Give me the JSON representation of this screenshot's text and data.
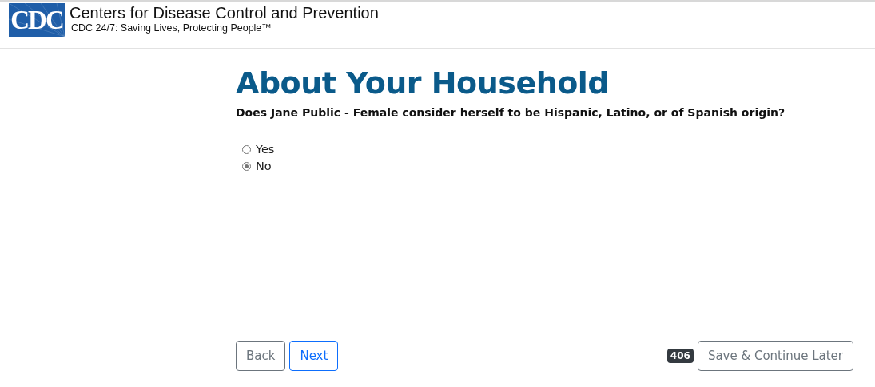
{
  "header": {
    "logo": "CDC",
    "title": "Centers for Disease Control and Prevention",
    "tagline": "CDC 24/7: Saving Lives, Protecting People™"
  },
  "page": {
    "heading": "About Your Household",
    "question": "Does Jane Public - Female consider herself to be Hispanic, Latino, or of Spanish origin?"
  },
  "options": [
    {
      "label": "Yes",
      "selected": false
    },
    {
      "label": "No",
      "selected": true
    }
  ],
  "footer": {
    "back": "Back",
    "next": "Next",
    "badge": "406",
    "save": "Save & Continue Later"
  }
}
